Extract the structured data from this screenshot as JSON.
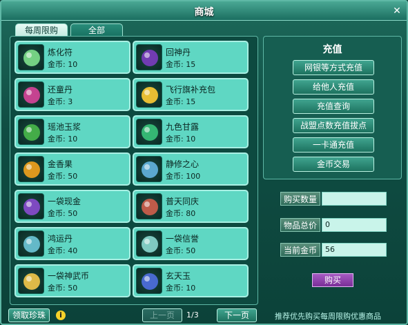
{
  "window": {
    "title": "商城"
  },
  "tabs": [
    {
      "label": "每周限购"
    },
    {
      "label": "全部"
    }
  ],
  "items": [
    {
      "name": "炼化符",
      "price": "金币: 10",
      "icon": "talisman-icon"
    },
    {
      "name": "回神丹",
      "price": "金币: 15",
      "icon": "grape-pill-icon"
    },
    {
      "name": "还童丹",
      "price": "金币: 3",
      "icon": "pink-pearl-icon"
    },
    {
      "name": "飞行旗补充包",
      "price": "金币: 15",
      "icon": "flag-pack-icon"
    },
    {
      "name": "瑶池玉浆",
      "price": "金币: 10",
      "icon": "green-jar-icon"
    },
    {
      "name": "九色甘露",
      "price": "金币: 10",
      "icon": "green-gem-icon"
    },
    {
      "name": "金香果",
      "price": "金币: 50",
      "icon": "golden-fruit-icon"
    },
    {
      "name": "静修之心",
      "price": "金币: 100",
      "icon": "heart-gem-icon"
    },
    {
      "name": "一袋现金",
      "price": "金币: 50",
      "icon": "money-bag-icon"
    },
    {
      "name": "普天同庆",
      "price": "金币: 80",
      "icon": "potion-bottle-icon"
    },
    {
      "name": "鸿运丹",
      "price": "金币: 40",
      "icon": "vase-icon"
    },
    {
      "name": "一袋信誉",
      "price": "金币: 50",
      "icon": "reputation-bag-icon"
    },
    {
      "name": "一袋神武币",
      "price": "金币: 50",
      "icon": "coin-bag-icon"
    },
    {
      "name": "玄天玉",
      "price": "金币: 10",
      "icon": "jade-icon"
    }
  ],
  "recharge": {
    "title": "充值",
    "buttons": [
      "网银等方式充值",
      "给他人充值",
      "充值查询",
      "战盟点数充值拔点",
      "一卡通充值",
      "金币交易"
    ]
  },
  "purchase": {
    "quantity_label": "购买数量",
    "quantity_value": "",
    "total_label": "物品总价",
    "total_value": "0",
    "balance_label": "当前金币",
    "balance_value": "56",
    "buy_label": "购买"
  },
  "footer": {
    "claim_label": "领取珍珠",
    "prev_label": "上一页",
    "page_text": "1/3",
    "next_label": "下一页",
    "tip": "推荐优先购买每周限购优惠商品"
  }
}
